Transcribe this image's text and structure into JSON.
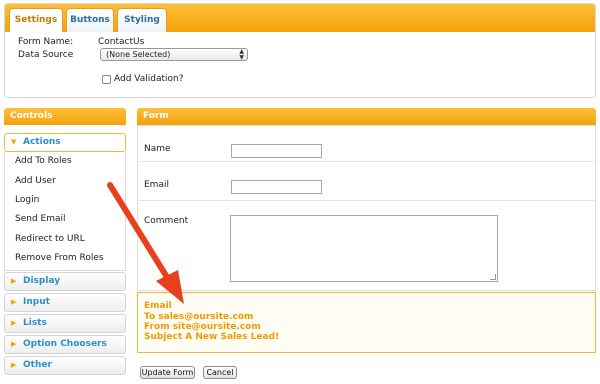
{
  "tabs": [
    {
      "label": "Settings",
      "active": true
    },
    {
      "label": "Buttons",
      "active": false
    },
    {
      "label": "Styling",
      "active": false
    }
  ],
  "settings": {
    "form_name_label": "Form Name:",
    "form_name_value": "ContactUs",
    "data_source_label": "Data Source",
    "data_source_value": "(None Selected)",
    "validation_label": "Add Validation?",
    "validation_checked": false
  },
  "controls": {
    "header": "Controls",
    "groups": [
      {
        "label": "Actions",
        "open": true,
        "items": [
          "Add To Roles",
          "Add User",
          "Login",
          "Send Email",
          "Redirect to URL",
          "Remove From Roles"
        ]
      },
      {
        "label": "Display",
        "open": false
      },
      {
        "label": "Input",
        "open": false
      },
      {
        "label": "Lists",
        "open": false
      },
      {
        "label": "Option Choosers",
        "open": false
      },
      {
        "label": "Other",
        "open": false
      }
    ]
  },
  "form": {
    "header": "Form",
    "fields": [
      {
        "label": "Name",
        "value": ""
      },
      {
        "label": "Email",
        "value": ""
      },
      {
        "label": "Comment",
        "value": ""
      }
    ],
    "email_action": {
      "title": "Email",
      "to": "To sales@oursite.com",
      "from": "From site@oursite.com",
      "subject": "Subject A New Sales Lead!"
    },
    "update_button": "Update Form",
    "cancel_button": "Cancel"
  },
  "colors": {
    "accent": "#f3a20a",
    "link": "#2b8fc9",
    "annotation_arrow": "#e8401c"
  }
}
